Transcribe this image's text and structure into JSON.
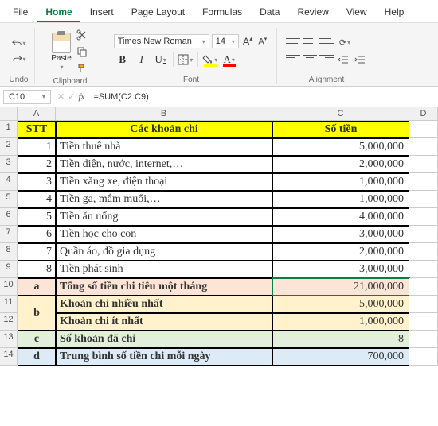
{
  "menu": {
    "items": [
      "File",
      "Home",
      "Insert",
      "Page Layout",
      "Formulas",
      "Data",
      "Review",
      "View",
      "Help"
    ],
    "active": "Home"
  },
  "ribbon": {
    "undo_label": "Undo",
    "clipboard_label": "Clipboard",
    "paste_label": "Paste",
    "font_label": "Font",
    "align_label": "Alignment",
    "font_name": "Times New Roman",
    "font_size": "14",
    "bold": "B",
    "italic": "I",
    "underline": "U",
    "inc": "A",
    "dec": "A",
    "fill": "A",
    "color": "A"
  },
  "namebox": "C10",
  "fx": "fx",
  "formula": "=SUM(C2:C9)",
  "columns": [
    "A",
    "B",
    "C",
    "D"
  ],
  "rows": [
    "1",
    "2",
    "3",
    "4",
    "5",
    "6",
    "7",
    "8",
    "9",
    "10",
    "11",
    "12",
    "13",
    "14"
  ],
  "headers": {
    "stt": "STT",
    "khoan": "Các khoản chi",
    "tien": "Số tiền"
  },
  "data_rows": [
    {
      "stt": "1",
      "name": "Tiền thuê nhà",
      "amount": "5,000,000"
    },
    {
      "stt": "2",
      "name": "Tiền điện, nước, internet,…",
      "amount": "2,000,000"
    },
    {
      "stt": "3",
      "name": "Tiền xăng xe, điện thoại",
      "amount": "1,000,000"
    },
    {
      "stt": "4",
      "name": "Tiền ga, mắm muối,…",
      "amount": "1,000,000"
    },
    {
      "stt": "5",
      "name": "Tiền ăn uống",
      "amount": "4,000,000"
    },
    {
      "stt": "6",
      "name": "Tiền học cho con",
      "amount": "3,000,000"
    },
    {
      "stt": "7",
      "name": "Quần áo, đồ gia dụng",
      "amount": "2,000,000"
    },
    {
      "stt": "8",
      "name": "Tiền phát sinh",
      "amount": "3,000,000"
    }
  ],
  "summary": {
    "a": {
      "label": "a",
      "text": "Tổng số tiền chi tiêu một tháng",
      "value": "21,000,000"
    },
    "b1": {
      "label": "b",
      "text": "Khoản chi nhiều nhất",
      "value": "5,000,000"
    },
    "b2": {
      "label": "",
      "text": "Khoản chi ít nhất",
      "value": "1,000,000"
    },
    "c": {
      "label": "c",
      "text": "Số khoản đã chi",
      "value": "8"
    },
    "d": {
      "label": "d",
      "text": "Trung bình số tiền chi mỗi ngày",
      "value": "700,000"
    }
  },
  "chart_data": {
    "type": "table",
    "title": "Các khoản chi",
    "columns": [
      "STT",
      "Các khoản chi",
      "Số tiền"
    ],
    "rows": [
      [
        1,
        "Tiền thuê nhà",
        5000000
      ],
      [
        2,
        "Tiền điện, nước, internet,…",
        2000000
      ],
      [
        3,
        "Tiền xăng xe, điện thoại",
        1000000
      ],
      [
        4,
        "Tiền ga, mắm muối,…",
        1000000
      ],
      [
        5,
        "Tiền ăn uống",
        4000000
      ],
      [
        6,
        "Tiền học cho con",
        3000000
      ],
      [
        7,
        "Quần áo, đồ gia dụng",
        2000000
      ],
      [
        8,
        "Tiền phát sinh",
        3000000
      ]
    ],
    "summary": {
      "Tổng số tiền chi tiêu một tháng": 21000000,
      "Khoản chi nhiều nhất": 5000000,
      "Khoản chi ít nhất": 1000000,
      "Số khoản đã chi": 8,
      "Trung bình số tiền chi mỗi ngày": 700000
    }
  }
}
